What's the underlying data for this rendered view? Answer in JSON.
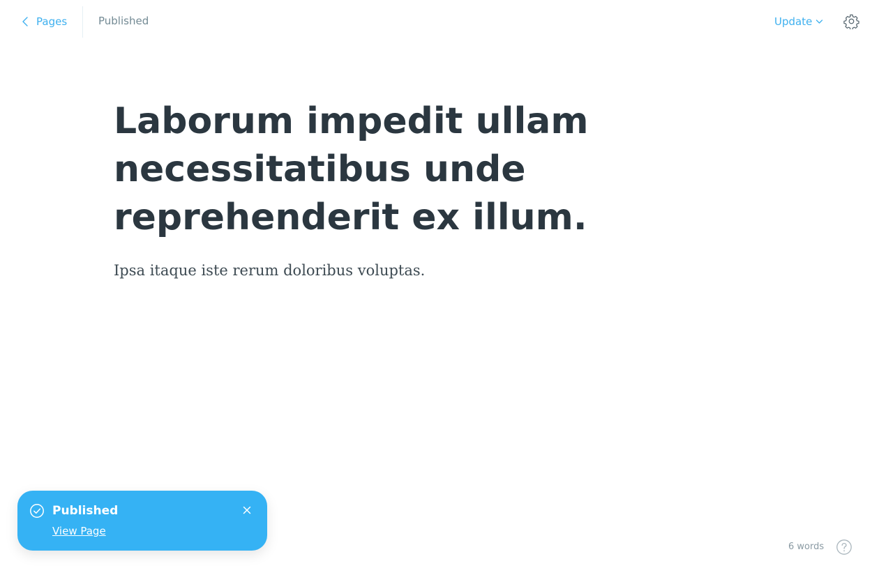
{
  "header": {
    "back_label": "Pages",
    "status": "Published",
    "update_label": "Update"
  },
  "post": {
    "title": "Laborum impedit ullam necessitatibus unde reprehenderit ex illum.",
    "body": "Ipsa itaque iste rerum doloribus voluptas."
  },
  "toast": {
    "title": "Published",
    "link_label": "View Page"
  },
  "footer": {
    "word_count": "6 words"
  },
  "icons": {
    "back": "chevron-left-icon",
    "update": "chevron-down-icon",
    "settings": "gear-icon",
    "toast_status": "check-circle-icon",
    "toast_close": "close-icon",
    "help": "help-circle-icon"
  },
  "colors": {
    "accent": "#3eb0ef",
    "toast_bg": "#35b2f4",
    "title_text": "#2b3740",
    "muted_text": "#738a94"
  }
}
